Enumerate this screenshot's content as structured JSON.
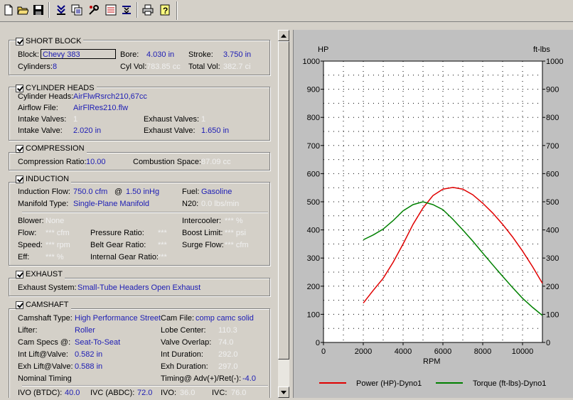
{
  "toolbar": {
    "buttons": [
      "new-icon",
      "open-icon",
      "save-icon",
      "import-icon",
      "copy-icon",
      "tools-icon",
      "compare-icon",
      "results-icon",
      "print-icon",
      "help-icon"
    ]
  },
  "short_block": {
    "title": "SHORT BLOCK",
    "block_label": "Block:",
    "block_value": "Chevy 383",
    "bore_label": "Bore:",
    "bore_value": "4.030 in",
    "stroke_label": "Stroke:",
    "stroke_value": "3.750 in",
    "cyl_label": "Cylinders:",
    "cyl_value": "8",
    "cylvol_label": "Cyl Vol:",
    "cylvol_value": "783.85 cc",
    "totalvol_label": "Total Vol:",
    "totalvol_value": "382.7 ci"
  },
  "cylinder_heads": {
    "title": "CYLINDER HEADS",
    "heads_label": "Cylinder Heads:",
    "heads_value": "AirFlwRsrch210,67cc",
    "airflow_label": "Airflow File:",
    "airflow_value": "AirFlRes210.flw",
    "iv_count_label": "Intake Valves:",
    "iv_count_value": "1",
    "ev_count_label": "Exhaust Valves:",
    "ev_count_value": "1",
    "iv_label": "Intake Valve:",
    "iv_value": "2.020 in",
    "ev_label": "Exhaust Valve:",
    "ev_value": "1.650 in"
  },
  "compression": {
    "title": "COMPRESSION",
    "cr_label": "Compression Ratio:",
    "cr_value": "10.00",
    "cs_label": "Combustion Space:",
    "cs_value": "87.09 cc"
  },
  "induction": {
    "title": "INDUCTION",
    "flow_label": "Induction Flow:",
    "flow_value": "750.0 cfm",
    "at": "@",
    "flow_pressure": "1.50 inHg",
    "fuel_label": "Fuel:",
    "fuel_value": "Gasoline",
    "manifold_label": "Manifold Type:",
    "manifold_value": "Single-Plane Manifold",
    "n20_label": "N20:",
    "n20_value": "0.0 lbs/min",
    "blower_label": "Blower:",
    "blower_value": "None",
    "intercooler_label": "Intercooler:",
    "intercooler_value": "*** %",
    "bflow_label": "Flow:",
    "bflow_value": "*** cfm",
    "pratio_label": "Pressure Ratio:",
    "pratio_value": "***",
    "boost_label": "Boost Limit:",
    "boost_value": "*** psi",
    "speed_label": "Speed:",
    "speed_value": "*** rpm",
    "belt_label": "Belt Gear Ratio:",
    "belt_value": "***",
    "surge_label": "Surge Flow:",
    "surge_value": "*** cfm",
    "eff_label": "Eff:",
    "eff_value": "*** %",
    "igr_label": "Internal Gear Ratio:",
    "igr_value": "***"
  },
  "exhaust": {
    "title": "EXHAUST",
    "system_label": "Exhaust System:",
    "system_value": "Small-Tube Headers Open Exhaust"
  },
  "camshaft": {
    "title": "CAMSHAFT",
    "type_label": "Camshaft Type:",
    "type_value": "High Performance Street",
    "file_label": "Cam File:",
    "file_value": "comp camc solid",
    "lifter_label": "Lifter:",
    "lifter_value": "Roller",
    "lobe_label": "Lobe Center:",
    "lobe_value": "110.3",
    "specs_label": "Cam Specs @:",
    "specs_value": "Seat-To-Seat",
    "overlap_label": "Valve Overlap:",
    "overlap_value": "74.0",
    "intlift_label": "Int Lift@Valve:",
    "intlift_value": "0.582 in",
    "intdur_label": "Int Duration:",
    "intdur_value": "292.0",
    "exhlift_label": "Exh Lift@Valve:",
    "exhlift_value": "0.588 in",
    "exhdur_label": "Exh Duration:",
    "exhdur_value": "297.0",
    "timing_label": "Nominal Timing",
    "advret_label": "Timing@ Adv(+)/Ret(-):",
    "advret_value": "-4.0",
    "ivo_label": "IVO  (BTDC):",
    "ivo_value": "40.0",
    "ivc_label": "IVC  (ABDC):",
    "ivc_value": "72.0",
    "ivo2_label": "IVO:",
    "ivo2_value": "36.0",
    "ivc2_label": "IVC:",
    "ivc2_value": "76.0"
  },
  "colors": {
    "power": "#e00000",
    "torque": "#008000",
    "value_text": "#1c1cb4"
  },
  "chart_data": {
    "type": "line",
    "xlabel": "RPM",
    "ylabel_left": "HP",
    "ylabel_right": "ft-lbs",
    "xlim": [
      0,
      11000
    ],
    "ylim": [
      0,
      1000
    ],
    "xticks": [
      0,
      2000,
      4000,
      6000,
      8000,
      10000
    ],
    "yticks": [
      0,
      100,
      200,
      300,
      400,
      500,
      600,
      700,
      800,
      900,
      1000
    ],
    "grid": true,
    "legend_position": "bottom",
    "series": [
      {
        "name": "Power (HP)-Dyno1",
        "x": [
          2000,
          2500,
          3000,
          3500,
          4000,
          4500,
          5000,
          5500,
          6000,
          6500,
          7000,
          7500,
          8000,
          8500,
          9000,
          9500,
          10000,
          10500,
          11000
        ],
        "y": [
          140,
          185,
          228,
          285,
          350,
          420,
          478,
          522,
          545,
          551,
          545,
          525,
          495,
          460,
          420,
          375,
          325,
          270,
          210
        ]
      },
      {
        "name": "Torque (ft-lbs)-Dyno1",
        "x": [
          2000,
          2500,
          3000,
          3500,
          4000,
          4500,
          5000,
          5500,
          6000,
          6500,
          7000,
          7500,
          8000,
          8500,
          9000,
          9500,
          10000,
          10500,
          11000
        ],
        "y": [
          365,
          382,
          403,
          433,
          468,
          490,
          500,
          490,
          472,
          438,
          400,
          360,
          318,
          276,
          235,
          195,
          157,
          125,
          96
        ]
      }
    ]
  }
}
